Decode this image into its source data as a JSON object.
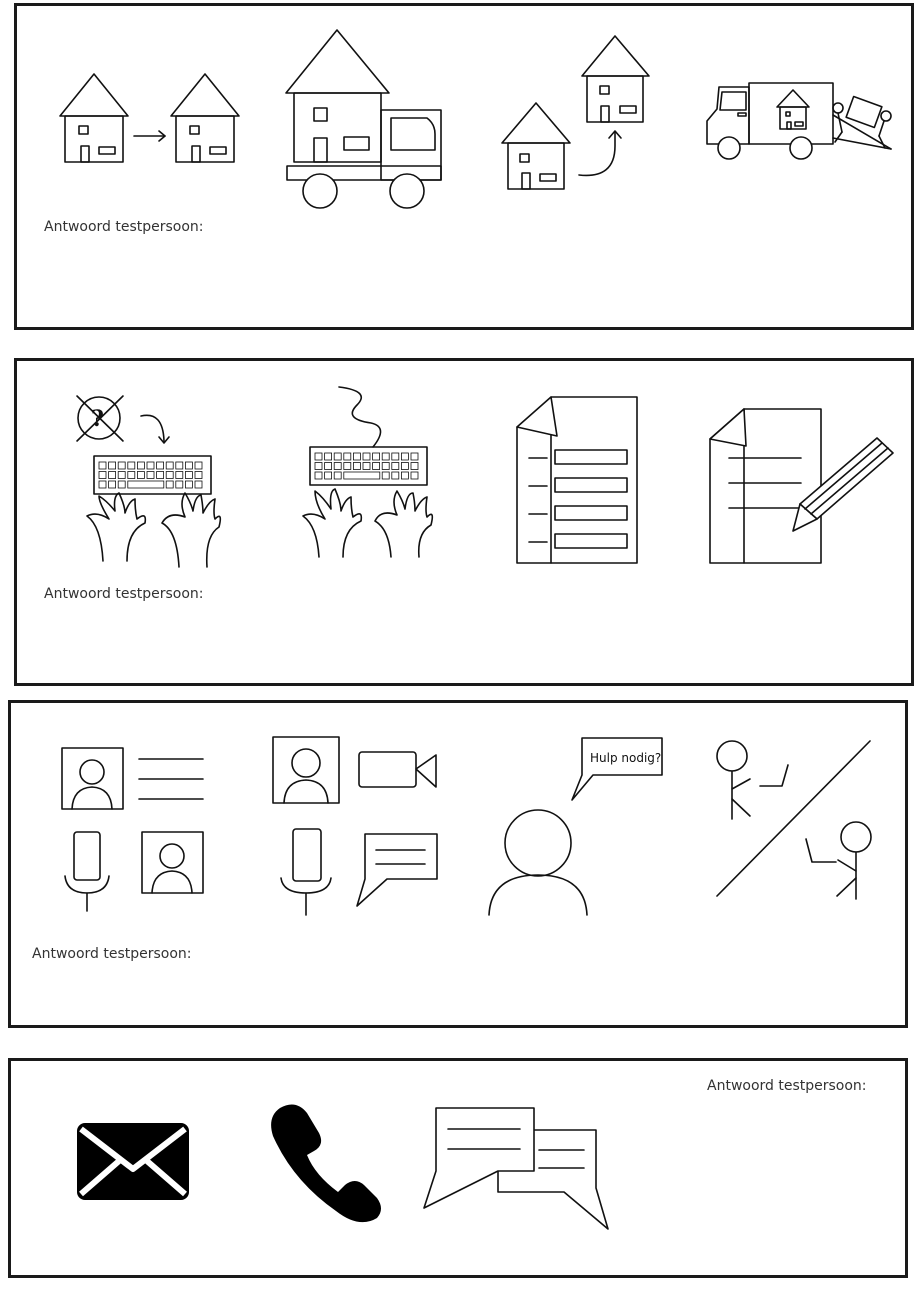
{
  "panels": [
    {
      "answer_label": "Antwoord testpersoon:",
      "icons": [
        "move-house-arrow-icon",
        "moving-truck-house-icon",
        "house-relocate-icon",
        "moving-van-loading-icon"
      ]
    },
    {
      "answer_label": "Antwoord testpersoon:",
      "icons": [
        "typing-no-question-icon",
        "typing-keyboard-icon",
        "form-document-icon",
        "document-writing-icon"
      ]
    },
    {
      "answer_label": "Antwoord testpersoon:",
      "bubble_text": "Hulp nodig?",
      "icons": [
        "video-contact-options-icon",
        "video-chat-options-icon",
        "help-person-icon",
        "separated-people-icon"
      ]
    },
    {
      "answer_label": "Antwoord testpersoon:",
      "icons": [
        "envelope-icon",
        "phone-icon",
        "chat-bubbles-icon"
      ]
    }
  ]
}
